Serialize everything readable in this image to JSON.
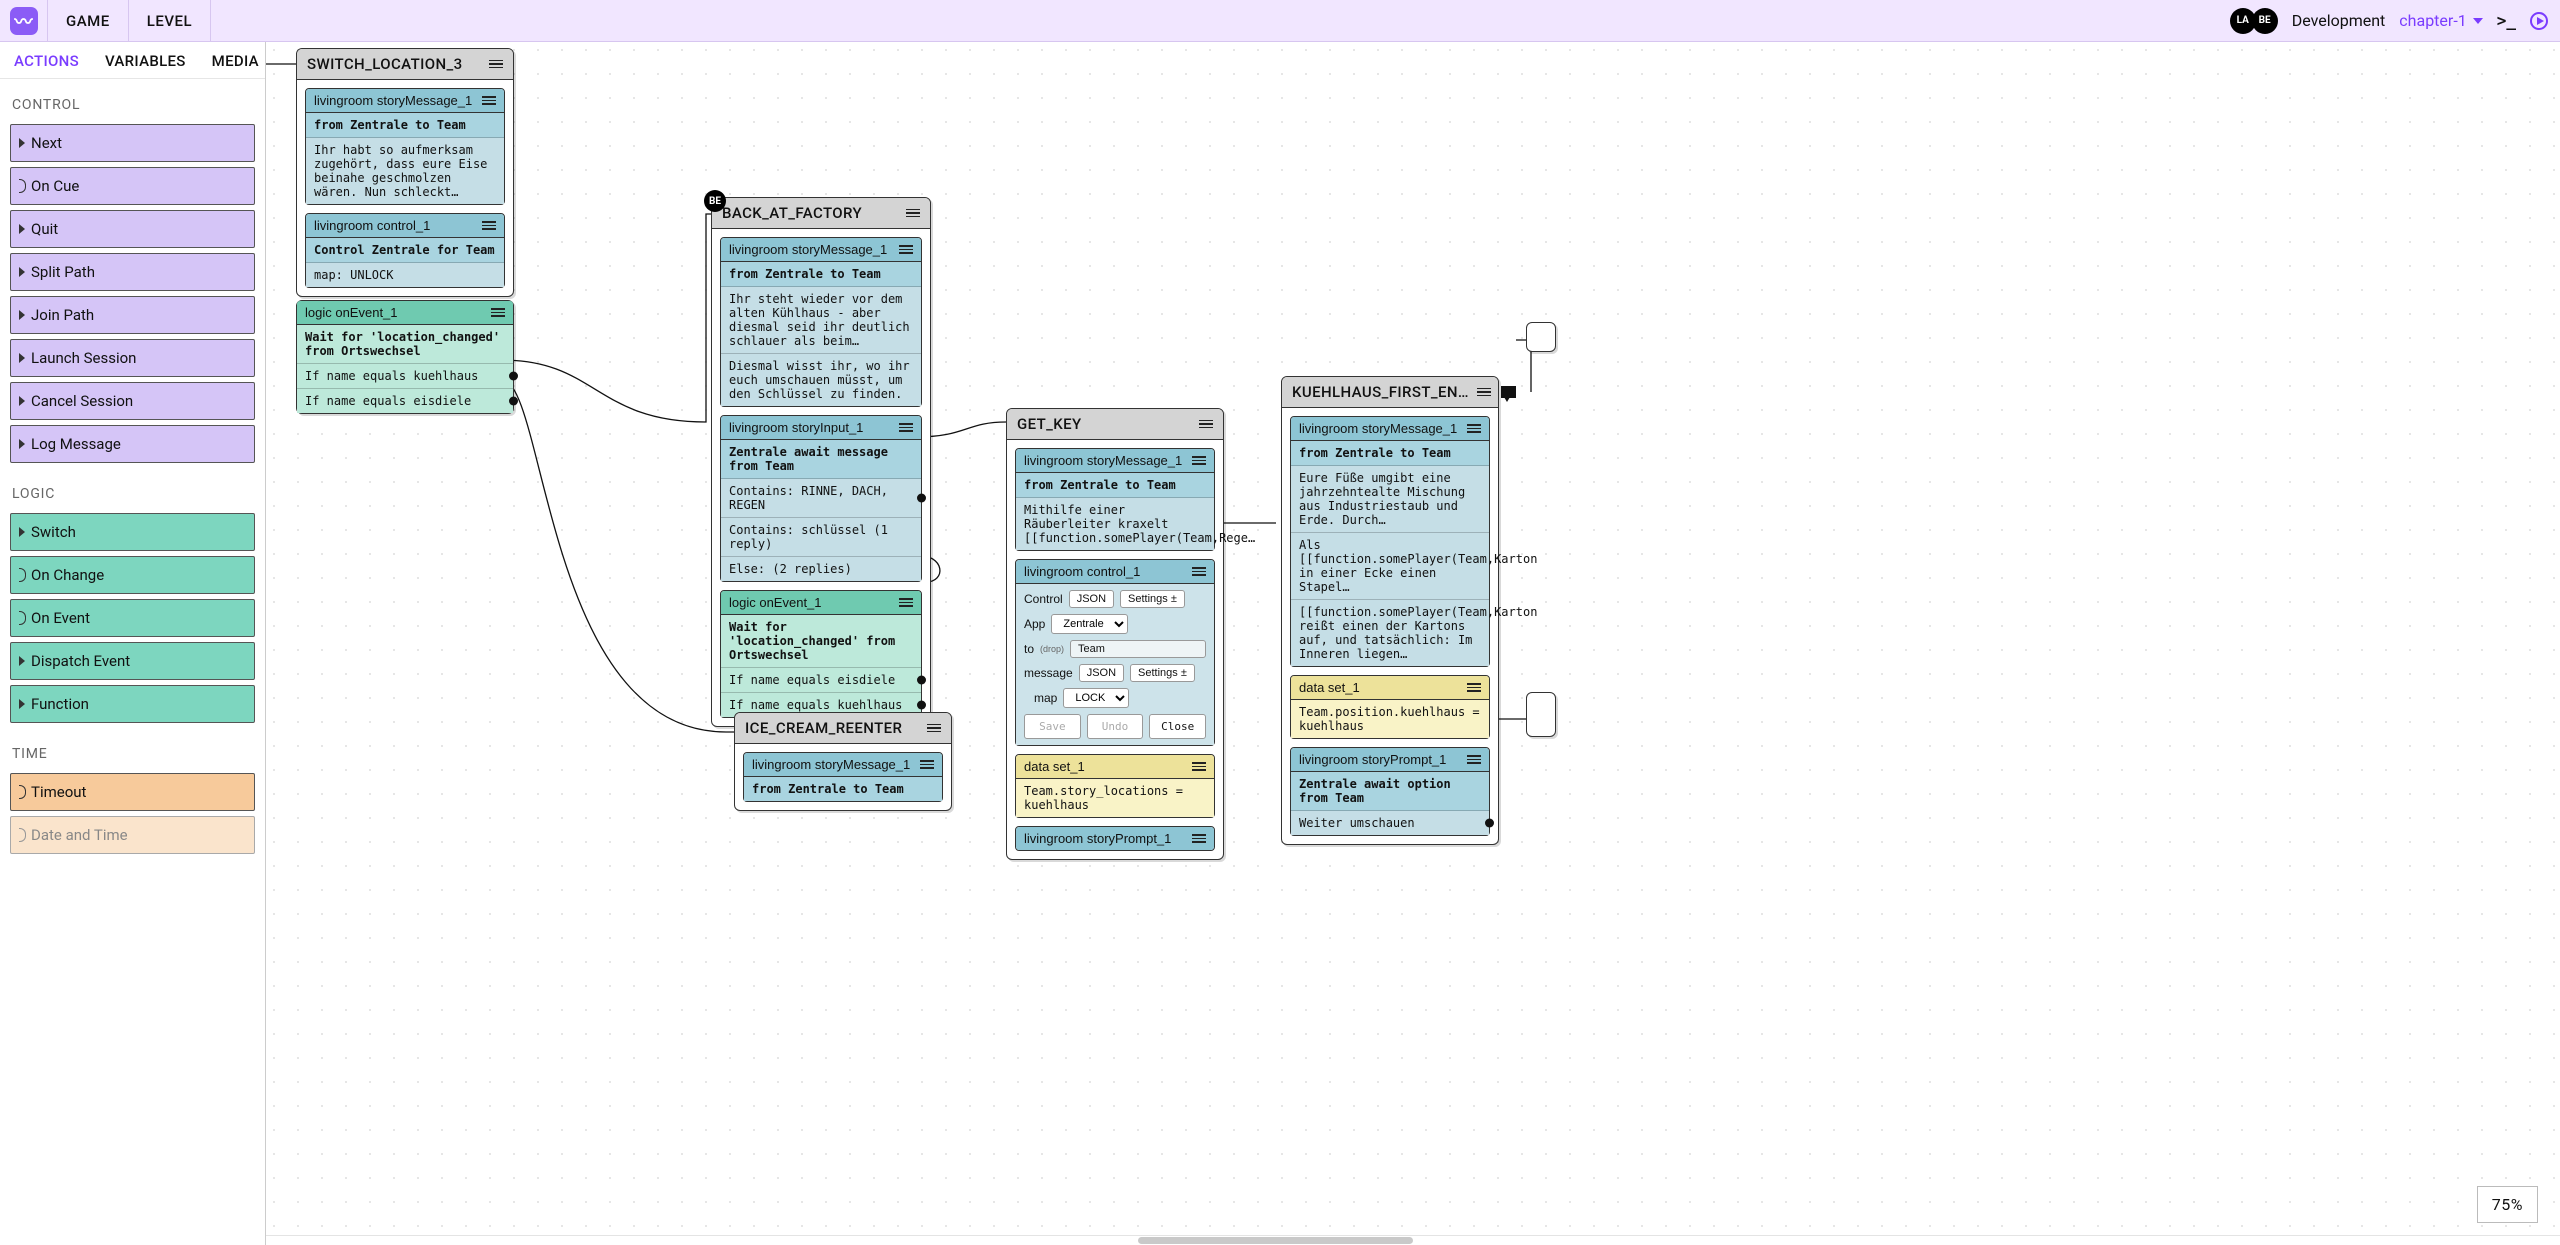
{
  "topbar": {
    "tabs": [
      "GAME",
      "LEVEL"
    ],
    "avatars": [
      "LA",
      "BE"
    ],
    "env": "Development",
    "chapter": "chapter-1"
  },
  "sidebar": {
    "tabs": {
      "actions": "ACTIONS",
      "variables": "VARIABLES",
      "media": "MEDIA"
    },
    "groups": {
      "control": {
        "title": "CONTROL",
        "items": [
          "Next",
          "On Cue",
          "Quit",
          "Split Path",
          "Join Path",
          "Launch Session",
          "Cancel Session",
          "Log Message"
        ]
      },
      "logic": {
        "title": "LOGIC",
        "items": [
          "Switch",
          "On Change",
          "On Event",
          "Dispatch Event",
          "Function"
        ]
      },
      "time": {
        "title": "TIME",
        "items": [
          "Timeout",
          "Date and Time"
        ]
      }
    }
  },
  "zoom": "75%",
  "nodes": {
    "switch_location": {
      "title": "SWITCH_LOCATION_3",
      "msg1": {
        "title": "livingroom storyMessage_1",
        "from": "from Zentrale to Team",
        "body": "Ihr habt so aufmerksam zugehört, dass eure Eise beinahe geschmolzen wären. Nun schleckt…"
      },
      "ctrl": {
        "title": "livingroom control_1",
        "line1": "Control Zentrale for Team",
        "line2": "map: UNLOCK"
      },
      "event": {
        "title": "logic onEvent_1",
        "wait": "Wait for 'location_changed' from Ortswechsel",
        "opts": [
          "If name equals kuehlhaus",
          "If name equals eisdiele"
        ]
      }
    },
    "back_at_factory": {
      "title": "BACK_AT_FACTORY",
      "avatar": "BE",
      "msg": {
        "title": "livingroom storyMessage_1",
        "from": "from Zentrale to Team",
        "body1": "Ihr steht wieder vor dem alten Kühlhaus - aber diesmal seid ihr deutlich schlauer als beim…",
        "body2": "Diesmal wisst ihr, wo ihr euch umschauen müsst, um den Schlüssel zu finden."
      },
      "input": {
        "title": "livingroom storyInput_1",
        "await": "Zentrale await message from Team",
        "rows": [
          "Contains: RINNE, DACH, REGEN",
          "Contains: schlüssel (1 reply)",
          "Else: (2 replies)"
        ]
      },
      "event": {
        "title": "logic onEvent_1",
        "wait": "Wait for 'location_changed' from Ortswechsel",
        "opts": [
          "If name equals eisdiele",
          "If name equals kuehlhaus"
        ]
      }
    },
    "get_key": {
      "title": "GET_KEY",
      "msg": {
        "title": "livingroom storyMessage_1",
        "from": "from Zentrale to Team",
        "body": "Mithilfe einer Räuberleiter kraxelt [[function.somePlayer(Team,Rege…"
      },
      "ctrl": {
        "title": "livingroom control_1",
        "rows": {
          "control": "Control",
          "app": "App",
          "app_val": "Zentrale",
          "to": "to",
          "to_hint": "(drop)",
          "to_val": "Team",
          "message": "message",
          "map": "map",
          "map_val": "LOCK"
        },
        "json": "JSON",
        "settings": "Settings ±",
        "buttons": [
          "Save",
          "Undo",
          "Close"
        ]
      },
      "set": {
        "title": "data set_1",
        "body": "Team.story_locations = kuehlhaus"
      },
      "prompt_title": "livingroom storyPrompt_1"
    },
    "kuehlhaus": {
      "title": "KUEHLHAUS_FIRST_EN…",
      "msg": {
        "title": "livingroom storyMessage_1",
        "from": "from Zentrale to Team",
        "b1": "Eure Füße umgibt eine jahrzehntealte Mischung aus Industriestaub und Erde. Durch…",
        "b2": "Als [[function.somePlayer(Team,Karton in einer Ecke einen Stapel…",
        "b3": "[[function.somePlayer(Team,Karton reißt einen der Kartons auf, und tatsächlich: Im Inneren liegen…"
      },
      "set": {
        "title": "data set_1",
        "body": "Team.position.kuehlhaus = kuehlhaus"
      },
      "prompt": {
        "title": "livingroom storyPrompt_1",
        "await": "Zentrale await option from Team",
        "opt": "Weiter umschauen"
      }
    },
    "ice_cream": {
      "title": "ICE_CREAM_REENTER",
      "msg": {
        "title": "livingroom storyMessage_1",
        "from": "from Zentrale to Team"
      }
    }
  }
}
